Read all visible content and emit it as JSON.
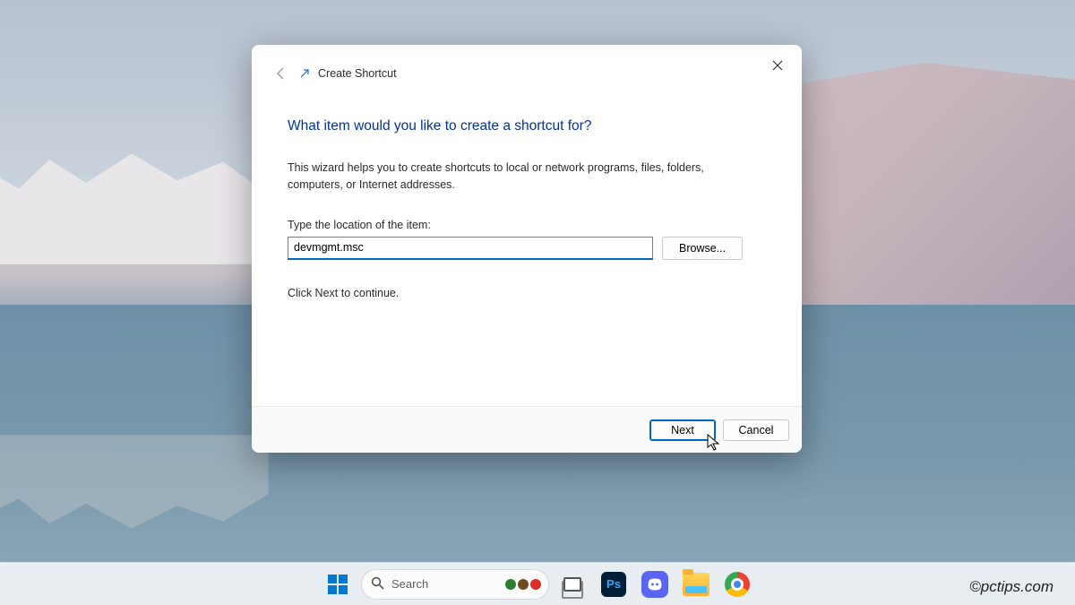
{
  "dialog": {
    "title": "Create Shortcut",
    "heading": "What item would you like to create a shortcut for?",
    "description": "This wizard helps you to create shortcuts to local or network programs, files, folders, computers, or Internet addresses.",
    "field_label": "Type the location of the item:",
    "location_value": "devmgmt.msc",
    "browse_label": "Browse...",
    "continue_text": "Click Next to continue.",
    "next_label": "Next",
    "cancel_label": "Cancel"
  },
  "taskbar": {
    "search_label": "Search"
  },
  "watermark": "©pctips.com"
}
